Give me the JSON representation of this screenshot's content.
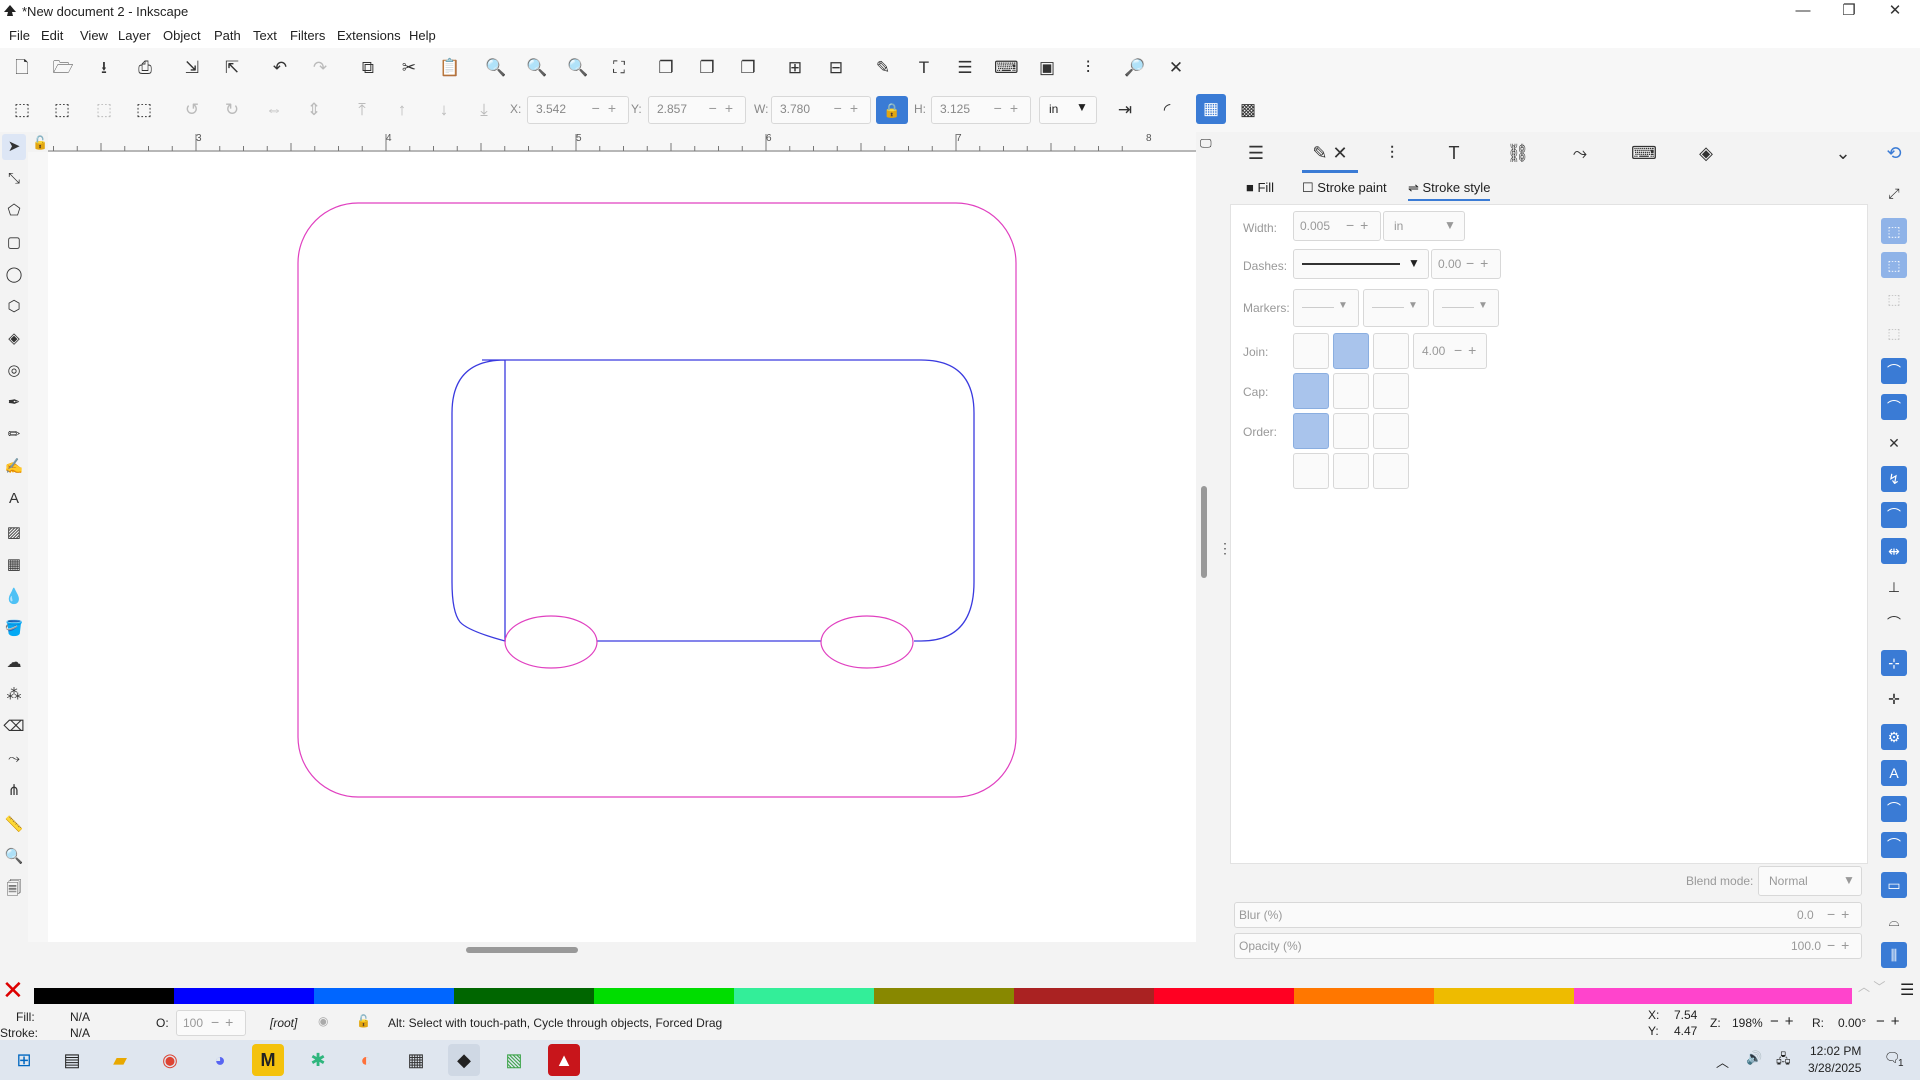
{
  "window": {
    "title": "*New document 2 - Inkscape",
    "minimize": "—",
    "maximize": "❐",
    "close": "✕"
  },
  "menu": [
    "File",
    "Edit",
    "View",
    "Layer",
    "Object",
    "Path",
    "Text",
    "Filters",
    "Extensions",
    "Help"
  ],
  "toolbar": {
    "x": {
      "label": "X:",
      "value": "3.542"
    },
    "y": {
      "label": "Y:",
      "value": "2.857"
    },
    "w": {
      "label": "W:",
      "value": "3.780"
    },
    "h": {
      "label": "H:",
      "value": "3.125"
    },
    "unit": "in"
  },
  "dock": {
    "subtabs": {
      "fill": "Fill",
      "stroke_paint": "Stroke paint",
      "stroke_style": "Stroke style"
    },
    "stroke": {
      "width_label": "Width:",
      "width_value": "0.005",
      "width_unit": "in",
      "dashes_label": "Dashes:",
      "dash_offset": "0.00",
      "markers_label": "Markers:",
      "join_label": "Join:",
      "miter_value": "4.00",
      "cap_label": "Cap:",
      "order_label": "Order:"
    },
    "blend_label": "Blend mode:",
    "blend_value": "Normal",
    "blur_label": "Blur (%)",
    "blur_value": "0.0",
    "opacity_label": "Opacity (%)",
    "opacity_value": "100.0"
  },
  "status": {
    "fill_label": "Fill:",
    "fill_value": "N/A",
    "stroke_label": "Stroke:",
    "stroke_value": "N/A",
    "opacity_label": "O:",
    "opacity_value": "100",
    "layer": "[root]",
    "message": "Alt: Select with touch-path, Cycle through objects, Forced Drag",
    "cursor_x_label": "X:",
    "cursor_x": "7.54",
    "cursor_y_label": "Y:",
    "cursor_y": "4.47",
    "zoom_label": "Z:",
    "zoom": "198%",
    "rotation_label": "R:",
    "rotation": "0.00°"
  },
  "ruler": {
    "ticks": [
      "3",
      "4",
      "5",
      "6",
      "7",
      "8"
    ]
  },
  "taskbar": {
    "time": "12:02 PM",
    "date": "3/28/2025",
    "notify_count": "1"
  },
  "palette": [
    "#000000",
    "#0000ff",
    "#0066ff",
    "#006600",
    "#00dd00",
    "#33ee99",
    "#888800",
    "#aa2222",
    "#ff0022",
    "#ff7700",
    "#eebb00",
    "#ff44cc"
  ],
  "colors": {
    "accent": "#3a7bd5",
    "outer_shape": "#e040c0",
    "inner_shape": "#3a3adf"
  }
}
